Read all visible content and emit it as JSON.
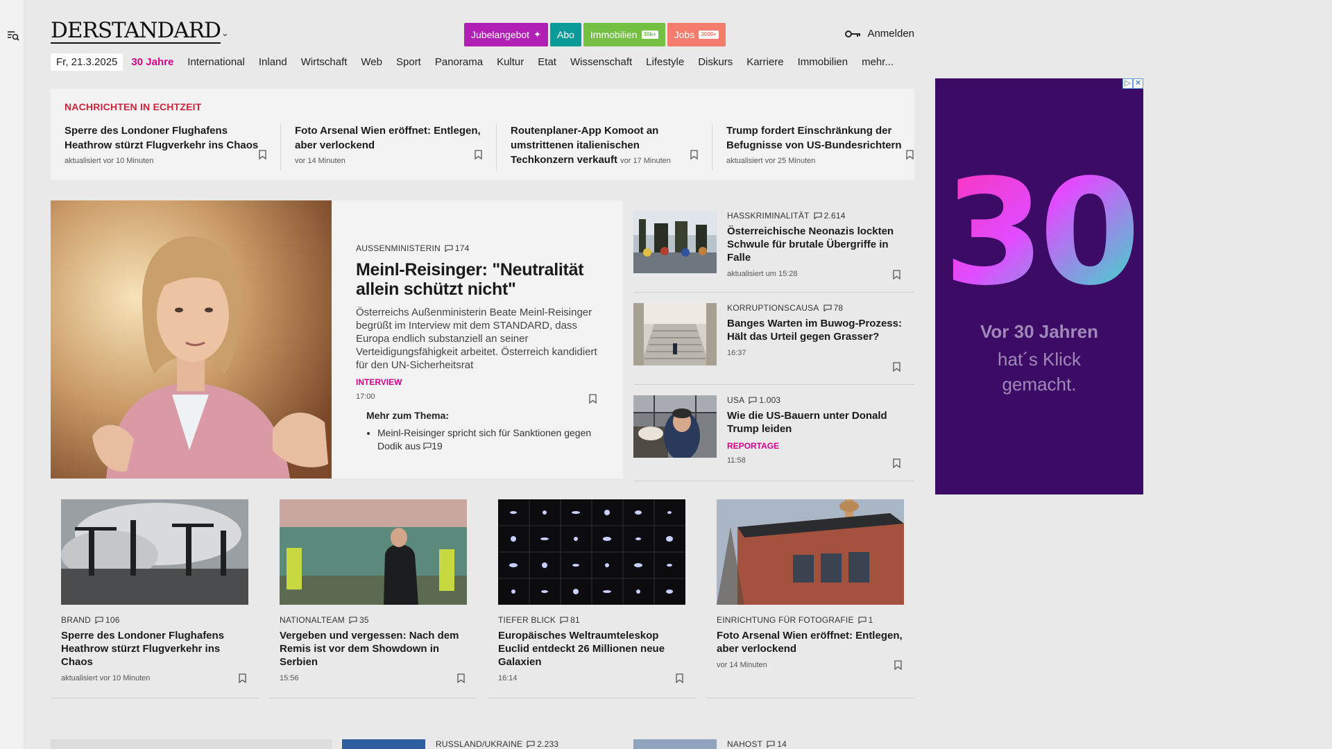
{
  "header": {
    "logo": "DERSTANDARD",
    "pills": [
      {
        "label": "Jubelangebot",
        "color": "#b21fb5"
      },
      {
        "label": "Abo",
        "color": "#0a9b99"
      },
      {
        "label": "Immobilien",
        "tag": "30k+",
        "color": "#73c043"
      },
      {
        "label": "Jobs",
        "tag": "3000+",
        "color": "#f47c6c"
      }
    ],
    "login": "Anmelden"
  },
  "nav": {
    "date": "Fr, 21.3.2025",
    "items": [
      "30 Jahre",
      "International",
      "Inland",
      "Wirtschaft",
      "Web",
      "Sport",
      "Panorama",
      "Kultur",
      "Etat",
      "Wissenschaft",
      "Lifestyle",
      "Diskurs",
      "Karriere",
      "Immobilien",
      "mehr..."
    ]
  },
  "ticker": {
    "title": "NACHRICHTEN IN ECHTZEIT",
    "items": [
      {
        "headline": "Sperre des Londoner Flughafens Heathrow stürzt Flugverkehr ins Chaos",
        "meta": "aktualisiert vor 10 Minuten"
      },
      {
        "headline": "Foto Arsenal Wien eröffnet: Entlegen, aber verlockend",
        "meta": "vor 14 Minuten"
      },
      {
        "headline": "Routenplaner-App Komoot an umstrittenen italienischen Techkonzern verkauft",
        "meta": "vor 17 Minuten"
      },
      {
        "headline": "Trump fordert Einschränkung der Befugnisse von US-Bundesrichtern",
        "meta": "aktualisiert vor 25 Minuten"
      }
    ]
  },
  "lead": {
    "kicker": "AUSSENMINISTERIN",
    "comments": "174",
    "title": "Meinl-Reisinger: \"Neutralität allein schützt nicht\"",
    "text": "Österreichs Außenministerin Beate Meinl-Reisinger begrüßt im Interview mit dem STANDARD, dass Europa endlich substanziell an seiner Verteidigungsfähigkeit arbeitet. Österreich kandidiert für den UN-Sicherheitsrat",
    "label": "INTERVIEW",
    "time": "17:00",
    "more_title": "Mehr zum Thema:",
    "more_item": "Meinl-Reisinger spricht sich für Sanktionen gegen Dodik aus",
    "more_comments": "19"
  },
  "side": [
    {
      "kicker": "HASSKRIMINALITÄT",
      "comments": "2.614",
      "headline": "Österreichische Neonazis lockten Schwule für brutale Übergriffe in Falle",
      "label": "",
      "time": "aktualisiert um 15:28"
    },
    {
      "kicker": "KORRUPTIONSCAUSA",
      "comments": "78",
      "headline": "Banges Warten im Buwog-Prozess: Hält das Urteil gegen Grasser?",
      "label": "",
      "time": "16:37"
    },
    {
      "kicker": "USA",
      "comments": "1.003",
      "headline": "Wie die US-Bauern unter Donald Trump leiden",
      "label": "REPORTAGE",
      "time": "11:58"
    }
  ],
  "cards": [
    {
      "kicker": "BRAND",
      "comments": "106",
      "headline": "Sperre des Londoner Flughafens Heathrow stürzt Flugverkehr ins Chaos",
      "time": "aktualisiert vor 10 Minuten"
    },
    {
      "kicker": "NATIONALTEAM",
      "comments": "35",
      "headline": "Vergeben und vergessen: Nach dem Remis ist vor dem Showdown in Serbien",
      "time": "15:56"
    },
    {
      "kicker": "TIEFER BLICK",
      "comments": "81",
      "headline": "Europäisches Weltraumteleskop Euclid entdeckt 26 Millionen neue Galaxien",
      "time": "16:14"
    },
    {
      "kicker": "EINRICHTUNG FÜR FOTOGRAFIE",
      "comments": "1",
      "headline": "Foto Arsenal Wien eröffnet: Entlegen, aber verlockend",
      "time": "vor 14 Minuten"
    }
  ],
  "bottom": [
    {
      "kicker": "RUSSLAND/UKRAINE",
      "comments": "2.233"
    },
    {
      "kicker": "NAHOST",
      "comments": "14"
    }
  ],
  "ad": {
    "number": "30",
    "line1": "Vor 30 Jahren",
    "line2": "hat´s Klick",
    "line3": "gemacht."
  }
}
